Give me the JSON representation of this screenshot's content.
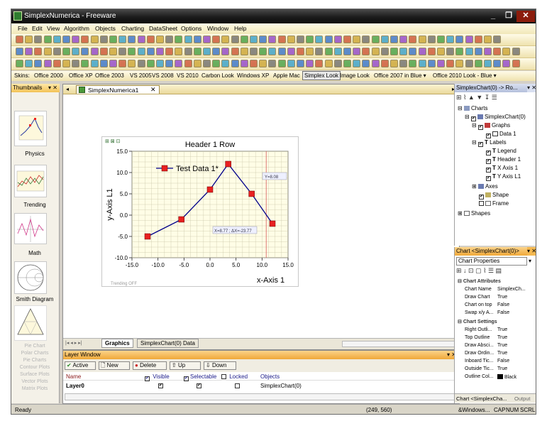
{
  "window": {
    "title": "SimplexNumerica - Freeware",
    "minimize": "_",
    "maximize": "❐",
    "close": "✕"
  },
  "menu": [
    "File",
    "Edit",
    "View",
    "Algorithm",
    "Objects",
    "Charting",
    "DataSheet",
    "Options",
    "Window",
    "Help"
  ],
  "skins": {
    "label": "Skins:",
    "items": [
      "Office 2000",
      "Office XP",
      "Office 2003",
      "VS 2005",
      "VS 2008",
      "VS 2010",
      "Carbon Look",
      "Windows XP",
      "Apple Mac",
      "Simplex Look",
      "Image Look",
      "Office 2007 in Blue ▾",
      "Office 2010 Look - Blue ▾"
    ],
    "selected": "Simplex Look"
  },
  "thumbnails": {
    "title": "Thumbnails",
    "items": [
      "Physics",
      "Trending",
      "Math",
      "Smith Diagram"
    ],
    "faded": [
      "Pie Chart",
      "Polar Charts",
      "Pie Charts",
      "Contour Plots",
      "Surface Plots",
      "Vector Plots",
      "Matrix Plots"
    ]
  },
  "document": {
    "tab_title": "SimplexNumerica1",
    "bottom_tabs": [
      "Graphics",
      "SimplexChart(0) Data"
    ]
  },
  "chart_data": {
    "type": "line",
    "title": "Header 1 Row",
    "xlabel": "x-Axis 1",
    "ylabel": "y-Axis L1",
    "xlim": [
      -15.0,
      15.0
    ],
    "ylim": [
      -10.0,
      15.0
    ],
    "xticks": [
      "-15.0",
      "-10.0",
      "-5.0",
      "0.0",
      "5.0",
      "10.0",
      "15.0"
    ],
    "yticks": [
      "15.0",
      "10.0",
      "5.0",
      "0.0",
      "-5.0",
      "-10.0"
    ],
    "grid": true,
    "legend_placement": "top-left",
    "series": [
      {
        "name": "Test Data 1*",
        "color": "#00008b",
        "marker_color": "#e82020",
        "x": [
          -12.0,
          -5.5,
          0.0,
          3.5,
          8.0,
          12.0
        ],
        "y": [
          -5.0,
          -1.0,
          6.0,
          12.0,
          5.0,
          -2.0
        ]
      }
    ],
    "cursor_label": "Y=8.08",
    "point_label": "X=8.77 ; ΔX=-23.77",
    "footnote": "Trending OFF",
    "cursor_x": 10.8
  },
  "layer_window": {
    "title": "Layer Window",
    "buttons": [
      "Active",
      "New",
      "Delete",
      "Up",
      "Down"
    ],
    "headers": [
      "Name",
      "Visible",
      "Selectable",
      "Locked",
      "Objects"
    ],
    "rows": [
      {
        "name": "Layer0",
        "objects": "SimplexChart(0)"
      }
    ]
  },
  "tree": {
    "title": "SimplexChart(0) -> Ro...",
    "items": [
      "Charts",
      "SimplexChart(0)",
      "Graphs",
      "Data 1",
      "Labels",
      "Legend",
      "Header 1",
      "X Axis 1",
      "Y Axis L1",
      "Axes",
      "Shape",
      "Frame",
      "Shapes"
    ]
  },
  "properties": {
    "panel_title": "Chart <SimplexChart(0)>",
    "header": "Chart Properties",
    "group1": "Chart Attributes",
    "rows1": [
      {
        "k": "Chart Name",
        "v": "SimplexCh..."
      },
      {
        "k": "Draw Chart",
        "v": "True"
      },
      {
        "k": "Chart on top",
        "v": "False"
      },
      {
        "k": "Swap x/y A...",
        "v": "False"
      }
    ],
    "group2": "Chart Settings",
    "rows2": [
      {
        "k": "Right Outli...",
        "v": "True"
      },
      {
        "k": "Top Outline",
        "v": "True"
      },
      {
        "k": "Draw Absci...",
        "v": "True"
      },
      {
        "k": "Draw Ordin...",
        "v": "True"
      },
      {
        "k": "Inboard Tic...",
        "v": "False"
      },
      {
        "k": "Outside Tic...",
        "v": "True"
      },
      {
        "k": "Outline Col...",
        "v": "Black"
      }
    ],
    "bottom_tabs": [
      "Chart <SimplexCha...",
      "Output"
    ]
  },
  "status": {
    "ready": "Ready",
    "coords": "(249, 560)",
    "right": "&Windows...",
    "cap": "CAP",
    "num": "NUM",
    "scrl": "SCRL"
  }
}
